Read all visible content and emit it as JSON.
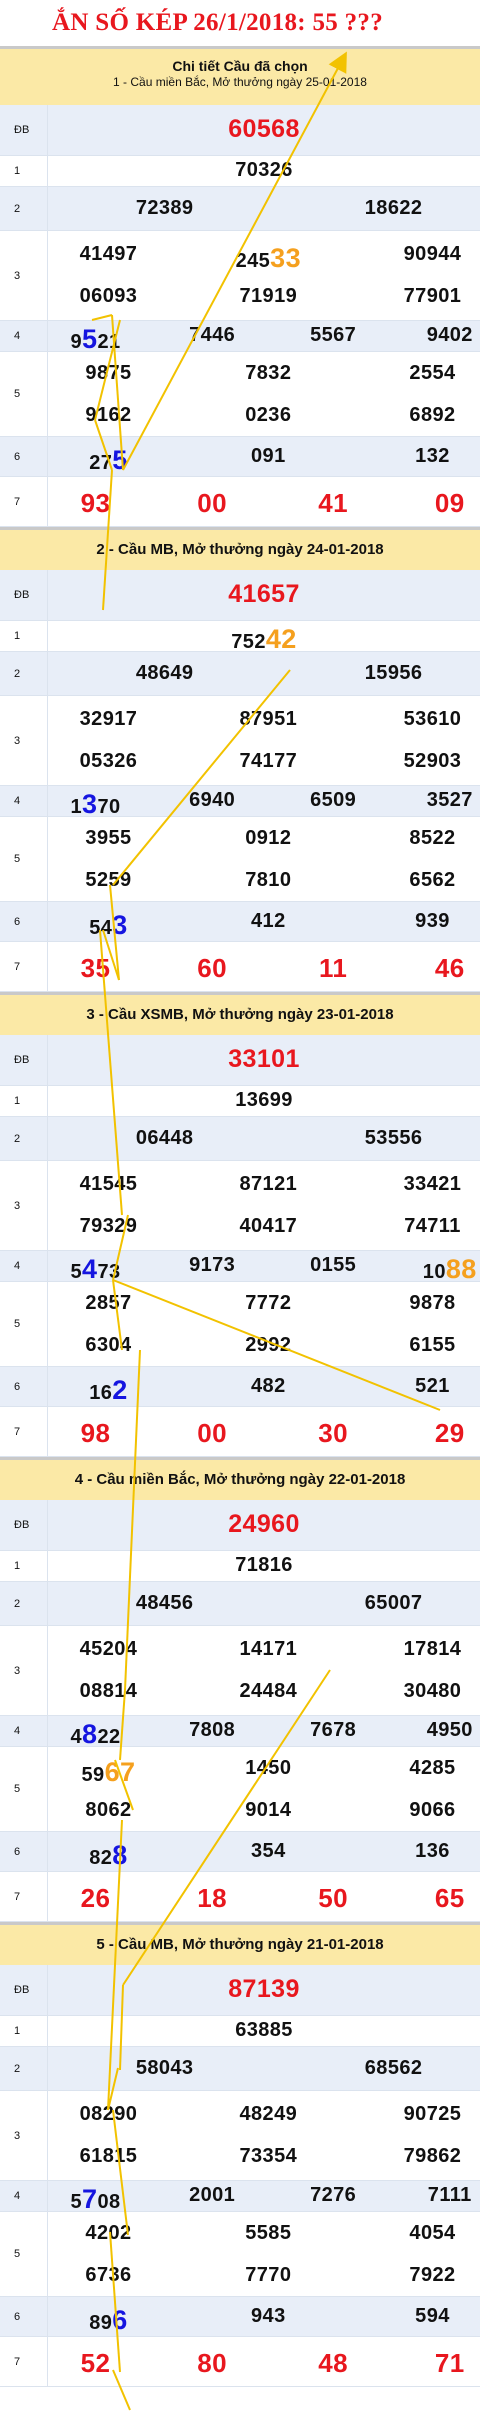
{
  "banner": "ẮN SỐ KÉP 26/1/2018: 55 ???",
  "first_header": {
    "title": "Chi tiết Cầu đã chọn",
    "subtitle": "1 - Cầu miền Bắc, Mở thưởng ngày 25-01-2018"
  },
  "labels": [
    "ĐB",
    "1",
    "2",
    "3",
    "4",
    "5",
    "6",
    "7"
  ],
  "colors": {
    "accent_red": "#e8171e",
    "highlight_blue": "#1515e0",
    "highlight_orange": "#f5a01e",
    "header_bg": "#fbe9a6",
    "arrow": "#f2c200"
  },
  "blocks": [
    {
      "title": "",
      "db": "60568",
      "g1": "70326",
      "g2": [
        "72389",
        "18622"
      ],
      "g3": [
        "41497",
        "24533",
        "90944",
        "06093",
        "71919",
        "77901"
      ],
      "g4": [
        "9521",
        "7446",
        "5567",
        "9402"
      ],
      "g5": [
        "9875",
        "7832",
        "2554",
        "9162",
        "0236",
        "6892"
      ],
      "g6": [
        "275",
        "091",
        "132"
      ],
      "g7": [
        "93",
        "00",
        "41",
        "09"
      ]
    },
    {
      "title": "2 - Cầu MB, Mở thưởng ngày 24-01-2018",
      "db": "41657",
      "g1": "75242",
      "g2": [
        "48649",
        "15956"
      ],
      "g3": [
        "32917",
        "87951",
        "53610",
        "05326",
        "74177",
        "52903"
      ],
      "g4": [
        "1370",
        "6940",
        "6509",
        "3527"
      ],
      "g5": [
        "3955",
        "0912",
        "8522",
        "5259",
        "7810",
        "6562"
      ],
      "g6": [
        "543",
        "412",
        "939"
      ],
      "g7": [
        "35",
        "60",
        "11",
        "46"
      ]
    },
    {
      "title": "3 - Cầu XSMB, Mở thưởng ngày 23-01-2018",
      "db": "33101",
      "g1": "13699",
      "g2": [
        "06448",
        "53556"
      ],
      "g3": [
        "41545",
        "87121",
        "33421",
        "79329",
        "40417",
        "74711"
      ],
      "g4": [
        "5473",
        "9173",
        "0155",
        "1088"
      ],
      "g5": [
        "2857",
        "7772",
        "9878",
        "6304",
        "2992",
        "6155"
      ],
      "g6": [
        "162",
        "482",
        "521"
      ],
      "g7": [
        "98",
        "00",
        "30",
        "29"
      ]
    },
    {
      "title": "4 - Cầu miền Bắc, Mở thưởng ngày 22-01-2018",
      "db": "24960",
      "g1": "71816",
      "g2": [
        "48456",
        "65007"
      ],
      "g3": [
        "45204",
        "14171",
        "17814",
        "08814",
        "24484",
        "30480"
      ],
      "g4": [
        "4822",
        "7808",
        "7678",
        "4950"
      ],
      "g5": [
        "5967",
        "1450",
        "4285",
        "8062",
        "9014",
        "9066"
      ],
      "g6": [
        "828",
        "354",
        "136"
      ],
      "g7": [
        "26",
        "18",
        "50",
        "65"
      ]
    },
    {
      "title": "5 - Cầu MB, Mở thưởng ngày 21-01-2018",
      "db": "87139",
      "g1": "63885",
      "g2": [
        "58043",
        "68562"
      ],
      "g3": [
        "08290",
        "48249",
        "90725",
        "61815",
        "73354",
        "79862"
      ],
      "g4": [
        "5708",
        "2001",
        "7276",
        "7111"
      ],
      "g5": [
        "4202",
        "5585",
        "4054",
        "6736",
        "7770",
        "7922"
      ],
      "g6": [
        "896",
        "943",
        "594"
      ],
      "g7": [
        "52",
        "80",
        "48",
        "71"
      ]
    }
  ]
}
